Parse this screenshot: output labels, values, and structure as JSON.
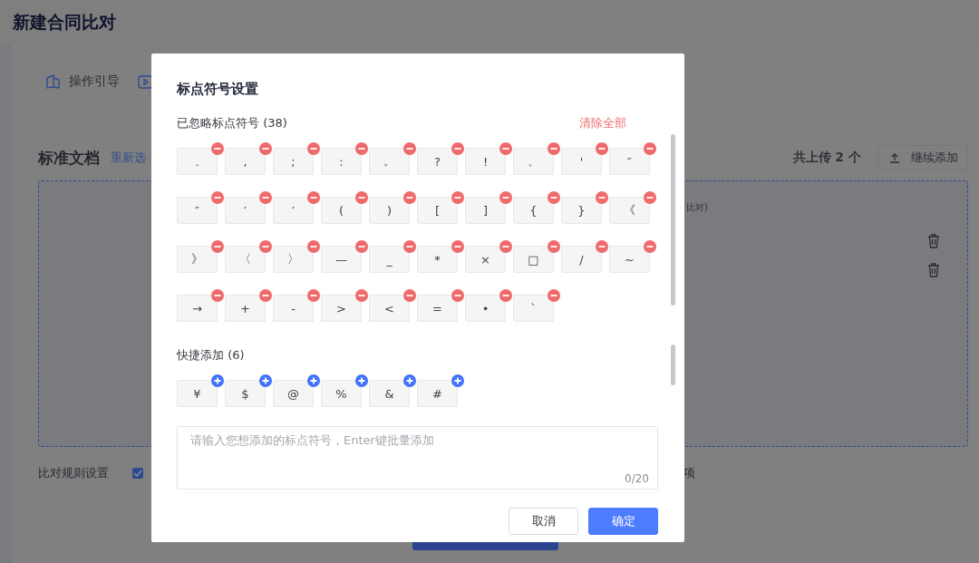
{
  "page": {
    "title": "新建合同比对",
    "guide": "操作引导",
    "section_title": "标准文档",
    "reselect_link": "重新选",
    "upload_count": "共上传 2 个",
    "add_more_button": "继续添加",
    "file_note": "比对)",
    "rules_label": "比对规则设置",
    "rules_checkbox": {
      "checked": true
    },
    "rules_tail": "项"
  },
  "dialog": {
    "title": "标点符号设置",
    "ignored_label": "已忽略标点符号 (38)",
    "clear_all": "清除全部",
    "ignored": [
      ".",
      ",",
      ";",
      ":",
      "。",
      "?",
      "!",
      "、",
      "'",
      "″",
      "″",
      "′",
      "′",
      "(",
      ")",
      "[",
      "]",
      "{",
      "}",
      "《",
      "》",
      "〈",
      "〉",
      "—",
      "_",
      "*",
      "×",
      "□",
      "/",
      "~",
      "→",
      "+",
      "-",
      ">",
      "<",
      "=",
      "•",
      "`"
    ],
    "quick_label": "快捷添加 (6)",
    "quick": [
      "¥",
      "$",
      "@",
      "%",
      "&",
      "#"
    ],
    "input": {
      "placeholder": "请输入您想添加的标点符号，Enter键批量添加",
      "counter": "0/20"
    },
    "buttons": [
      {
        "label": "取消",
        "kind": "secondary"
      },
      {
        "label": "确定",
        "kind": "primary"
      }
    ]
  }
}
